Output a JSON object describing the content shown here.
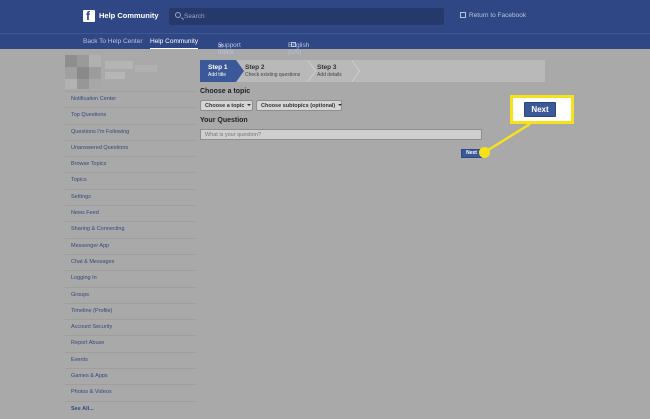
{
  "header": {
    "brand": "Help Community",
    "search_placeholder": "Search",
    "return_link": "Return to Facebook"
  },
  "subnav": {
    "back": "Back To Help Center",
    "community": "Help Community",
    "support_inbox": "Support Inbox",
    "language": "English (US)"
  },
  "sidebar": {
    "items": [
      "Notification Center",
      "Top Questions",
      "Questions I'm Following",
      "Unanswered Questions",
      "Browse Topics",
      "Topics",
      "Settings",
      "News Feed",
      "Sharing & Connecting",
      "Messenger App",
      "Chat & Messages",
      "Logging In",
      "Groups",
      "Timeline (Profile)",
      "Account Security",
      "Report Abuse",
      "Events",
      "Games & Apps",
      "Photos & Videos",
      "See All..."
    ]
  },
  "steps": [
    {
      "title": "Step 1",
      "subtitle": "Add title"
    },
    {
      "title": "Step 2",
      "subtitle": "Check existing questions"
    },
    {
      "title": "Step 3",
      "subtitle": "Add details"
    }
  ],
  "form": {
    "topic_heading": "Choose a topic",
    "topic_dropdown": "Choose a topic",
    "subtopic_dropdown": "Choose subtopics (optional)",
    "question_heading": "Your Question",
    "question_placeholder": "What is your question?",
    "next_label": "Next"
  },
  "callout": {
    "label": "Next",
    "color": "#f7e21a"
  },
  "colors": {
    "brand_blue": "#3b5998",
    "header_blue": "#2f4885"
  }
}
